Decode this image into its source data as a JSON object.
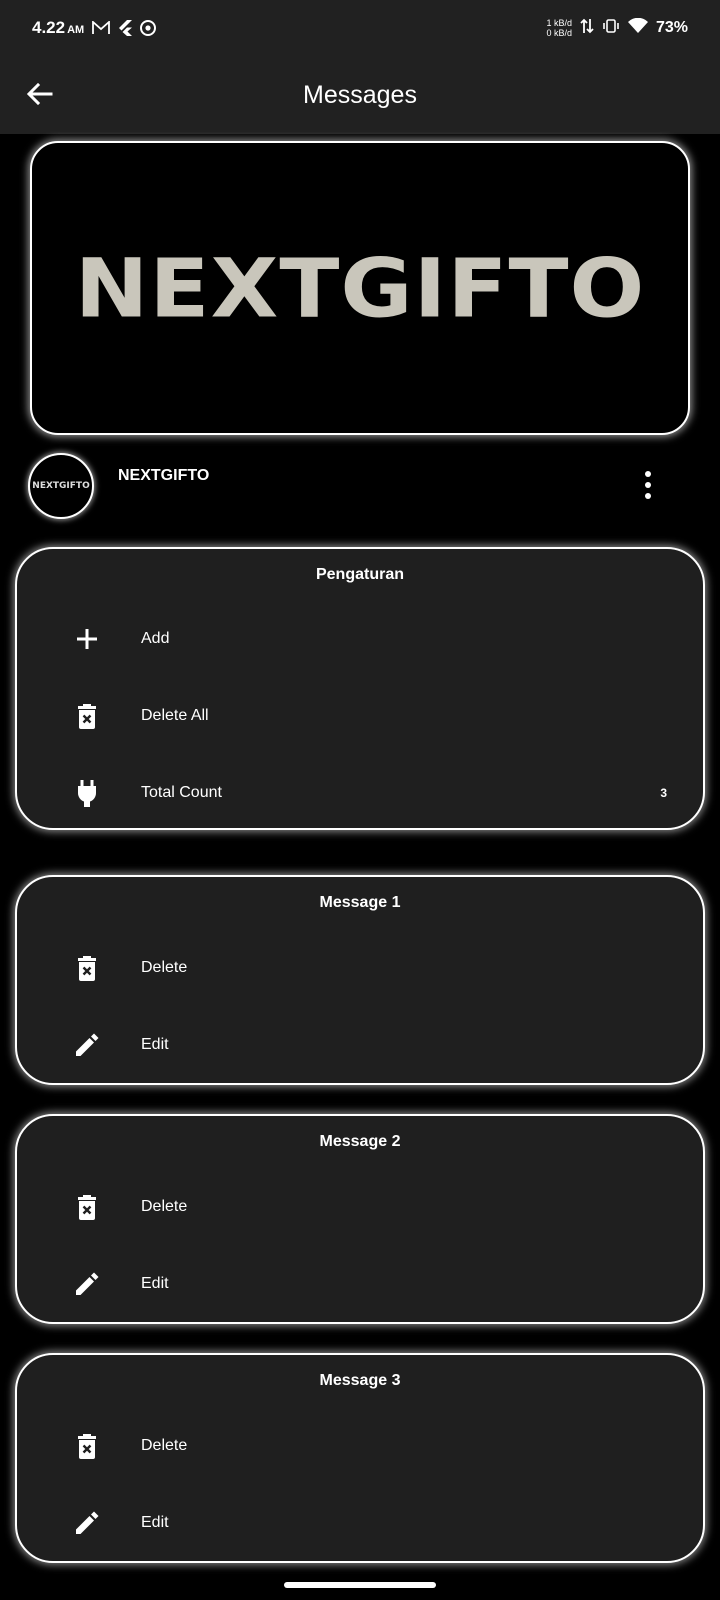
{
  "status_bar": {
    "time": "4.22",
    "ampm": "AM",
    "net_up": "1 kB/d",
    "net_down": "0 kB/d",
    "battery": "73%"
  },
  "app_bar": {
    "title": "Messages"
  },
  "banner": {
    "logo_text": "NEXTGIFTO"
  },
  "profile": {
    "avatar_text": "NEXTGIFTO",
    "name": "NEXTGIFTO"
  },
  "settings_card": {
    "title": "Pengaturan",
    "items": [
      {
        "label": "Add",
        "icon": "plus-icon"
      },
      {
        "label": "Delete All",
        "icon": "trash-x-icon"
      },
      {
        "label": "Total Count",
        "icon": "plug-icon",
        "value": "3"
      }
    ]
  },
  "messages": [
    {
      "title": "Message 1",
      "delete_label": "Delete",
      "edit_label": "Edit"
    },
    {
      "title": "Message 2",
      "delete_label": "Delete",
      "edit_label": "Edit"
    },
    {
      "title": "Message 3",
      "delete_label": "Delete",
      "edit_label": "Edit"
    }
  ]
}
